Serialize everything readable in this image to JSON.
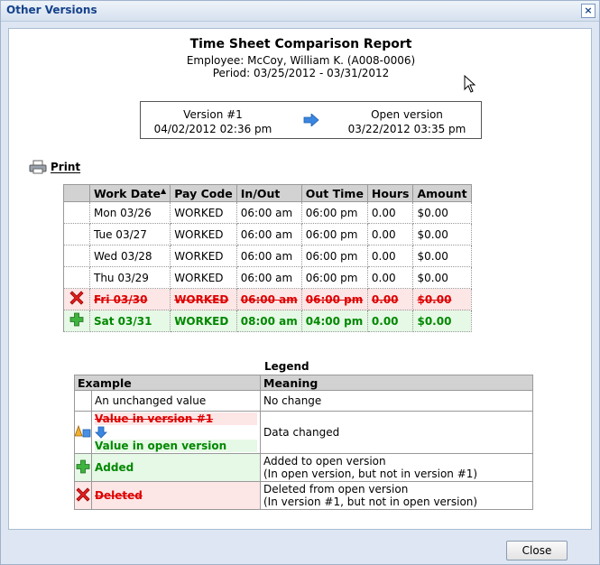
{
  "window": {
    "title": "Other Versions",
    "close_glyph": "×"
  },
  "report": {
    "title": "Time Sheet Comparison Report",
    "employee": "Employee: McCoy, William K. (A008-0006)",
    "period": "Period: 03/25/2012 - 03/31/2012"
  },
  "versions": {
    "left_label": "Version #1",
    "left_date": "04/02/2012 02:36 pm",
    "right_label": "Open version",
    "right_date": "03/22/2012 03:35 pm"
  },
  "print": {
    "label": "Print"
  },
  "table": {
    "columns": [
      "Work Date",
      "Pay Code",
      "In/Out",
      "Out Time",
      "Hours",
      "Amount"
    ],
    "sort_indicator": "▲",
    "rows": [
      {
        "status": "unchanged",
        "cells": [
          "Mon 03/26",
          "WORKED",
          "06:00 am",
          "06:00 pm",
          "0.00",
          "$0.00"
        ]
      },
      {
        "status": "unchanged",
        "cells": [
          "Tue 03/27",
          "WORKED",
          "06:00 am",
          "06:00 pm",
          "0.00",
          "$0.00"
        ]
      },
      {
        "status": "unchanged",
        "cells": [
          "Wed 03/28",
          "WORKED",
          "06:00 am",
          "06:00 pm",
          "0.00",
          "$0.00"
        ]
      },
      {
        "status": "unchanged",
        "cells": [
          "Thu 03/29",
          "WORKED",
          "06:00 am",
          "06:00 pm",
          "0.00",
          "$0.00"
        ]
      },
      {
        "status": "deleted",
        "cells": [
          "Fri 03/30",
          "WORKED",
          "06:00 am",
          "06:00 pm",
          "0.00",
          "$0.00"
        ]
      },
      {
        "status": "added",
        "cells": [
          "Sat 03/31",
          "WORKED",
          "08:00 am",
          "04:00 pm",
          "0.00",
          "$0.00"
        ]
      }
    ]
  },
  "legend": {
    "title": "Legend",
    "col_example": "Example",
    "col_meaning": "Meaning",
    "rows": [
      {
        "example": "An unchanged value",
        "meaning": "No change"
      },
      {
        "example_old": "Value in version #1",
        "example_new": "Value in open version",
        "meaning": "Data changed"
      },
      {
        "example": "Added",
        "meaning_1": "Added to open version",
        "meaning_2": "(In open version, but not in version #1)"
      },
      {
        "example": "Deleted",
        "meaning_1": "Deleted from open version",
        "meaning_2": "(In version #1, but not in open version)"
      }
    ]
  },
  "buttons": {
    "close": "Close"
  },
  "colors": {
    "deleted": "#dd0000",
    "added": "#008800",
    "header": "#15428b"
  }
}
